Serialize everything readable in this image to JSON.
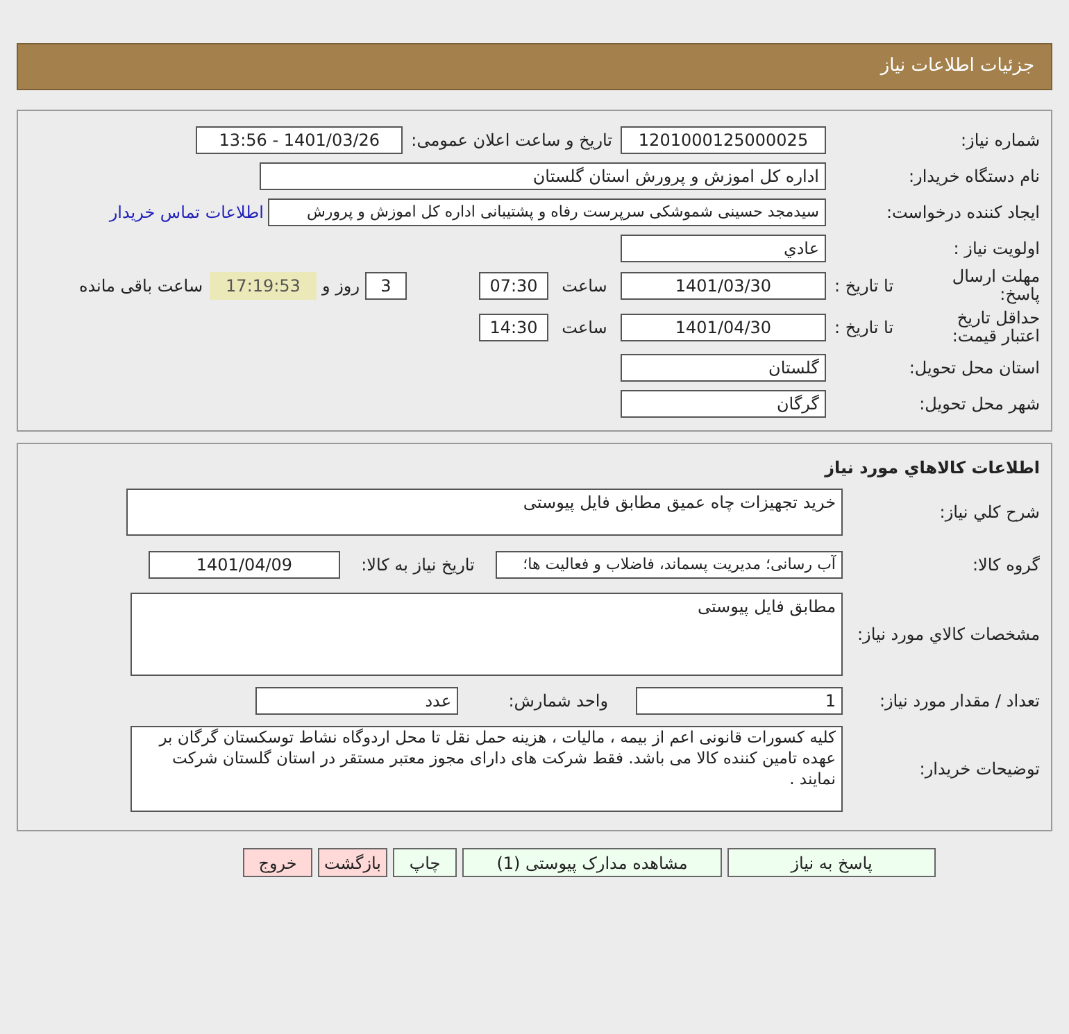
{
  "header": {
    "title": "جزئیات اطلاعات نیاز"
  },
  "need_info": {
    "need_number": {
      "label": "شماره نیاز:",
      "value": "1201000125000025"
    },
    "announce": {
      "label": "تاریخ و ساعت اعلان عمومی:",
      "value": "1401/03/26 - 13:56"
    },
    "buyer": {
      "label": "نام دستگاه خریدار:",
      "value": "اداره کل اموزش و پرورش استان گلستان"
    },
    "requester": {
      "label": "ایجاد کننده درخواست:",
      "value": "سیدمجد حسینی شموشکی سرپرست رفاه و پشتیبانی اداره کل اموزش و پرورش",
      "link": "اطلاعات تماس خریدار"
    },
    "priority": {
      "label": "اولویت نیاز :",
      "value": "عادي"
    },
    "deadline": {
      "label": "مهلت ارسال پاسخ:",
      "to_label": "تا تاریخ :",
      "date": "1401/03/30",
      "time_label": "ساعت",
      "time": "07:30",
      "days": "3",
      "days_label": "روز و",
      "remaining": "17:19:53",
      "remaining_label": "ساعت باقی مانده"
    },
    "validity": {
      "label": "حداقل تاریخ اعتبار قیمت:",
      "to_label": "تا تاریخ :",
      "date": "1401/04/30",
      "time_label": "ساعت",
      "time": "14:30"
    },
    "province": {
      "label": "استان محل تحویل:",
      "value": "گلستان"
    },
    "city": {
      "label": "شهر محل تحویل:",
      "value": "گرگان"
    }
  },
  "goods": {
    "title": "اطلاعات کالاهاي مورد نياز",
    "description": {
      "label": "شرح کلي نياز:",
      "value": "خرید تجهیزات چاه عمیق مطابق فایل پیوستی"
    },
    "group": {
      "label": "گروه کالا:",
      "value": "آب رسانی؛ مدیریت پسماند، فاضلاب و فعالیت ها؛",
      "date_label": "تاریخ نیاز به کالا:",
      "date": "1401/04/09"
    },
    "specs": {
      "label": "مشخصات کالاي مورد نياز:",
      "value": "مطابق فایل پیوستی"
    },
    "quantity": {
      "label": "تعداد / مقدار مورد نیاز:",
      "value": "1",
      "unit_label": "واحد شمارش:",
      "unit": "عدد"
    },
    "notes": {
      "label": "توضیحات خریدار:",
      "value": "کلیه کسورات قانونی اعم از بیمه ، مالیات ، هزینه حمل نقل تا محل اردوگاه نشاط توسکستان گرگان بر عهده تامین کننده کالا می باشد. فقط شرکت  های دارای مجوز معتبر مستقر در استان گلستان شرکت نمایند ."
    }
  },
  "buttons": [
    {
      "label": "پاسخ به نیاز",
      "kind": "action"
    },
    {
      "label": "مشاهده مدارک پیوستی (1)",
      "kind": "action"
    },
    {
      "label": "چاپ",
      "kind": "action"
    },
    {
      "label": "بازگشت",
      "kind": "exit"
    },
    {
      "label": "خروج",
      "kind": "exit"
    }
  ]
}
